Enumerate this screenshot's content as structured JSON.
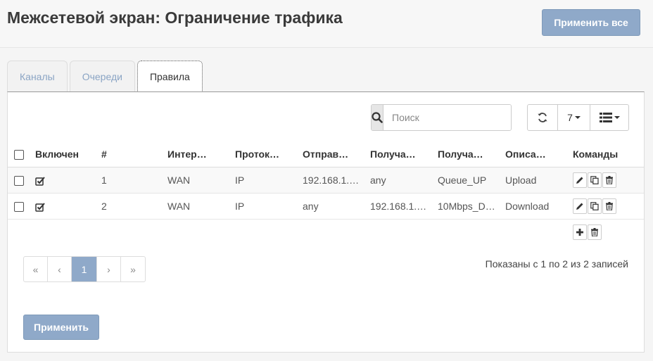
{
  "page": {
    "title": "Межсетевой экран: Ограничение трафика",
    "apply_all_label": "Применить все"
  },
  "tabs": [
    {
      "label": "Каналы",
      "active": false
    },
    {
      "label": "Очереди",
      "active": false
    },
    {
      "label": "Правила",
      "active": true
    }
  ],
  "toolbar": {
    "search_placeholder": "Поиск",
    "search_value": "",
    "rows_per_page": "7",
    "icons": [
      "search-icon",
      "refresh-icon",
      "columns-list-icon"
    ]
  },
  "table": {
    "columns": [
      "Включен",
      "#",
      "Интер…",
      "Проток…",
      "Отправ…",
      "Получа…",
      "Получа…",
      "Описа…",
      "Команды"
    ],
    "rows": [
      {
        "enabled": true,
        "num": "1",
        "interface": "WAN",
        "protocol": "IP",
        "source": "192.168.1.…",
        "destination": "any",
        "target": "Queue_UP",
        "description": "Upload"
      },
      {
        "enabled": true,
        "num": "2",
        "interface": "WAN",
        "protocol": "IP",
        "source": "any",
        "destination": "192.168.1.…",
        "target": "10Mbps_D…",
        "description": "Download"
      }
    ],
    "row_commands": [
      "edit-icon",
      "copy-icon",
      "delete-icon"
    ],
    "footer_commands": [
      "add-icon",
      "delete-icon"
    ]
  },
  "pagination": {
    "first": "«",
    "prev": "‹",
    "current": "1",
    "next": "›",
    "last": "»"
  },
  "info_text": "Показаны с 1 по 2 из 2 записей",
  "apply_label": "Применить",
  "colors": {
    "primary": "#8fa9c9",
    "tab_link": "#8aa4c4"
  }
}
